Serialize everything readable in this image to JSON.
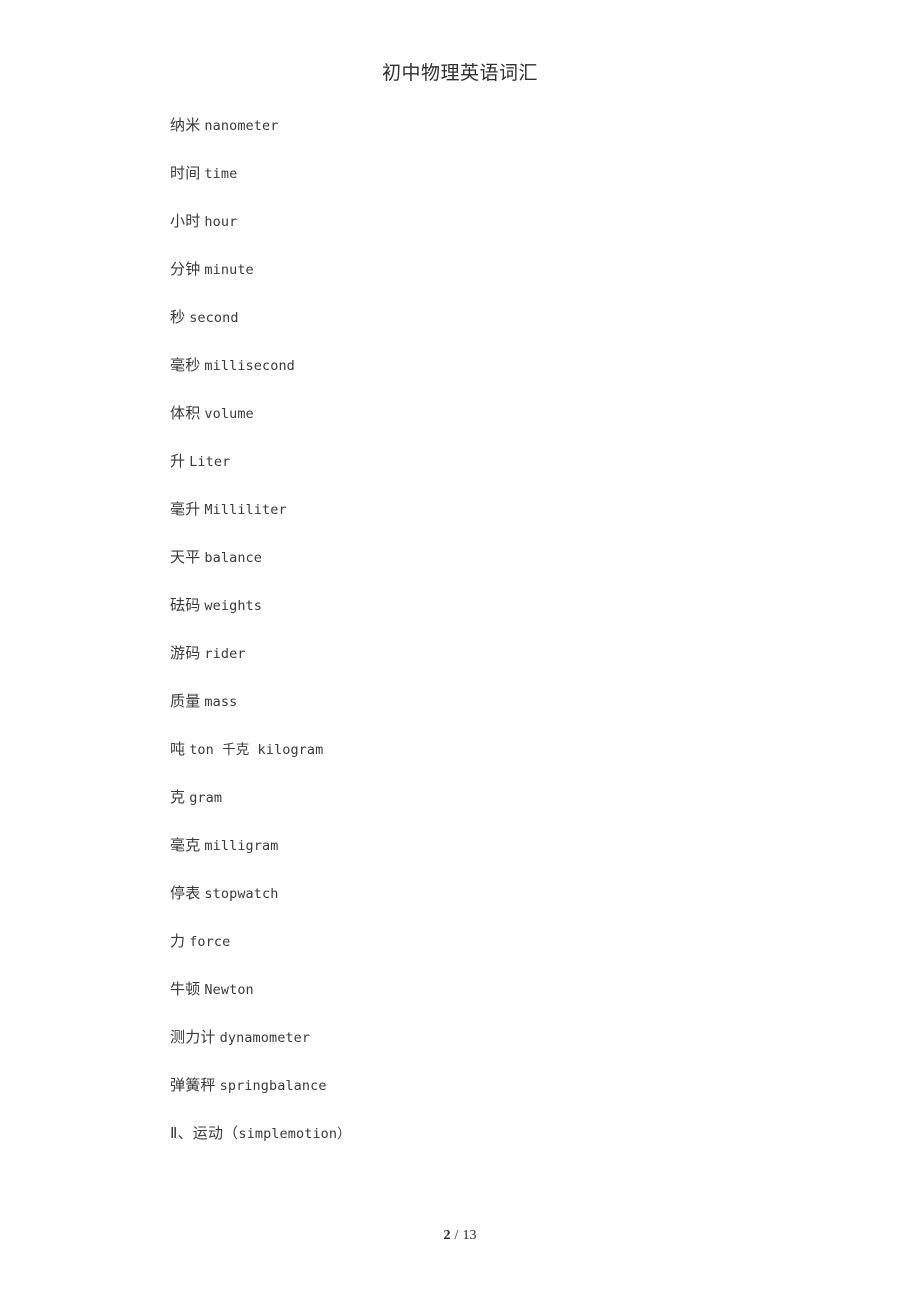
{
  "document": {
    "title": "初中物理英语词汇",
    "background_color": "#ffffff",
    "text_color": "#3a3a3a"
  },
  "vocabulary": [
    {
      "zh": "纳米",
      "en": "nanometer"
    },
    {
      "zh": "时间",
      "en": "time"
    },
    {
      "zh": "小时",
      "en": "hour"
    },
    {
      "zh": "分钟",
      "en": "minute"
    },
    {
      "zh": "秒",
      "en": "second"
    },
    {
      "zh": "毫秒",
      "en": "millisecond"
    },
    {
      "zh": "体积",
      "en": "volume"
    },
    {
      "zh": "升",
      "en": "Liter"
    },
    {
      "zh": "毫升",
      "en": "Milliliter"
    },
    {
      "zh": "天平",
      "en": "balance"
    },
    {
      "zh": "砝码",
      "en": "weights"
    },
    {
      "zh": "游码",
      "en": "rider"
    },
    {
      "zh": "质量",
      "en": "mass"
    },
    {
      "zh": "吨",
      "en": "ton 千克 kilogram"
    },
    {
      "zh": "克",
      "en": "gram"
    },
    {
      "zh": "毫克",
      "en": "milligram"
    },
    {
      "zh": "停表",
      "en": "stopwatch"
    },
    {
      "zh": "力",
      "en": "force"
    },
    {
      "zh": "牛顿",
      "en": "Newton"
    },
    {
      "zh": "测力计",
      "en": "dynamometer"
    },
    {
      "zh": "弹簧秤",
      "en": "springbalance"
    },
    {
      "zh": "Ⅱ、运动（",
      "en": "simplemotion）"
    }
  ],
  "footer": {
    "current_page": "2",
    "separator": "/",
    "total_pages": "13"
  }
}
